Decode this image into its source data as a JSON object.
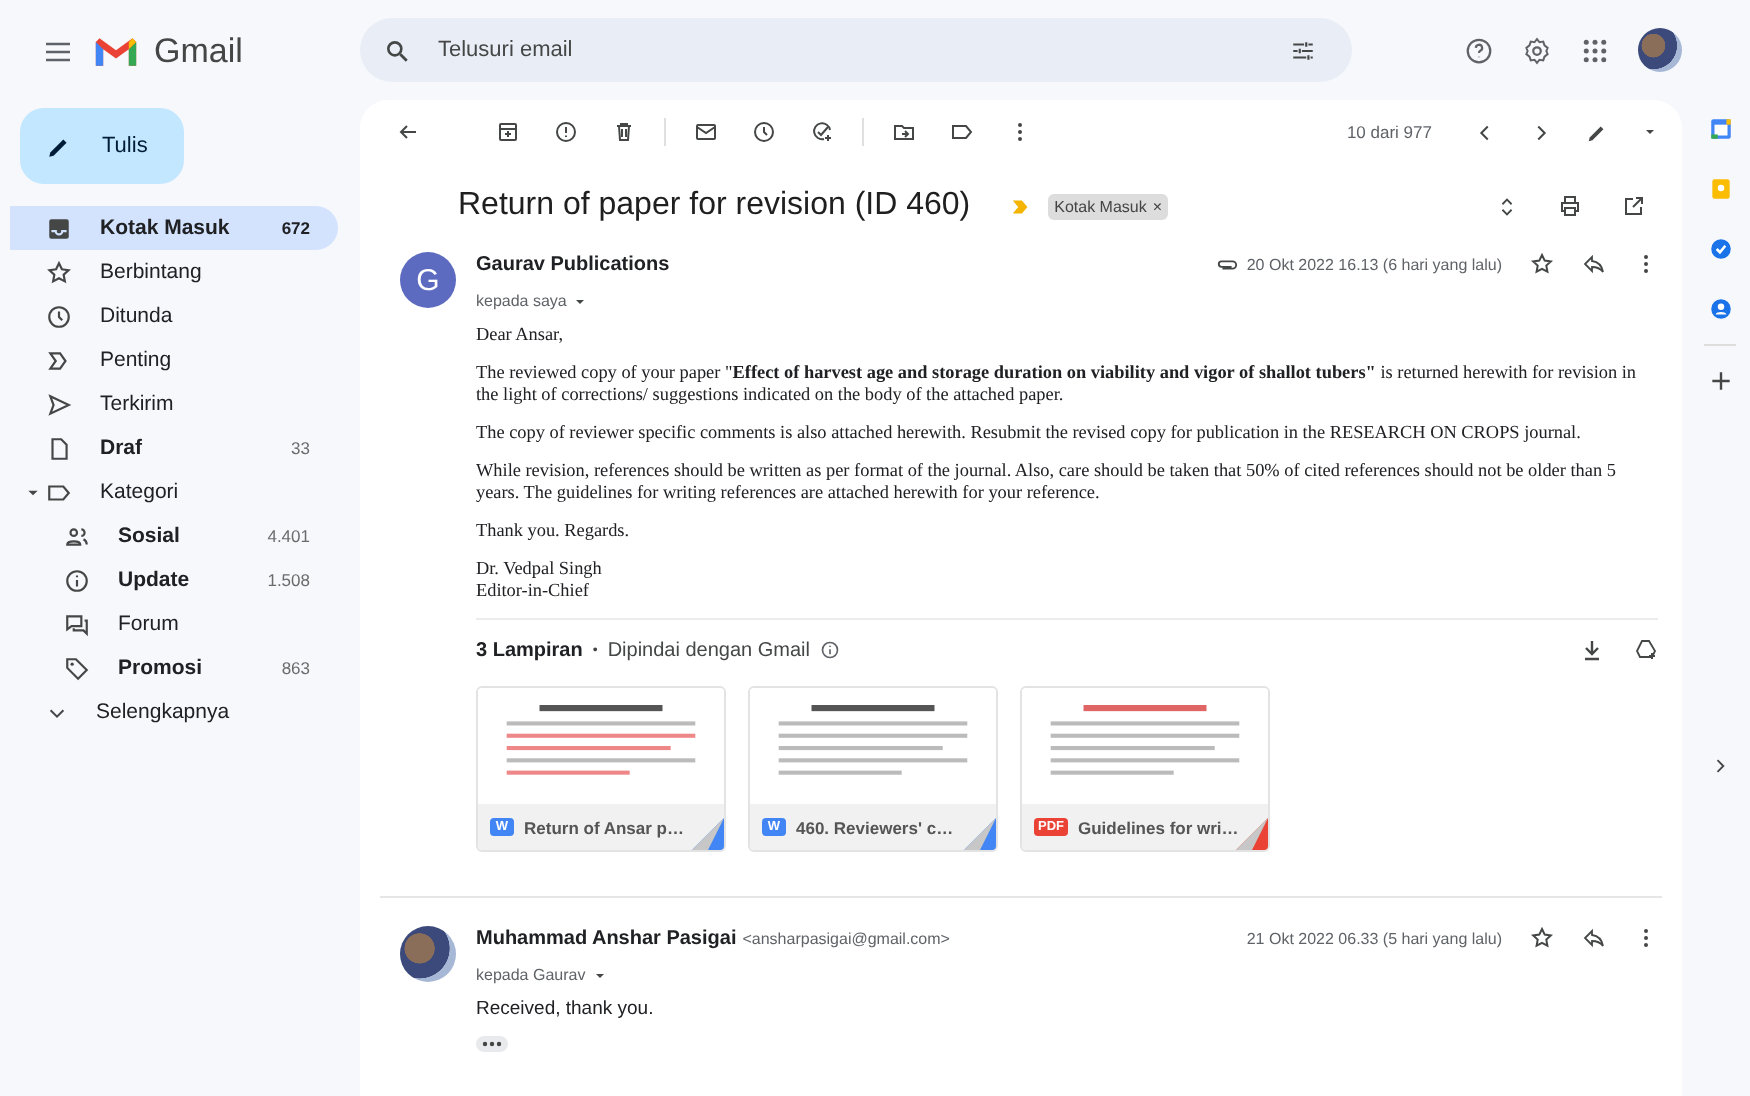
{
  "header": {
    "app_name": "Gmail",
    "search": {
      "placeholder": "Telusuri email"
    }
  },
  "compose_button": "Tulis",
  "sidebar": {
    "items": [
      {
        "label": "Kotak Masuk",
        "count": "672",
        "selected": true,
        "unread": true
      },
      {
        "label": "Berbintang",
        "selected": false,
        "unread": false
      },
      {
        "label": "Ditunda",
        "selected": false,
        "unread": false
      },
      {
        "label": "Penting",
        "selected": false,
        "unread": false
      },
      {
        "label": "Terkirim",
        "selected": false,
        "unread": false
      },
      {
        "label": "Draf",
        "count": "33",
        "selected": false,
        "unread": true
      },
      {
        "label": "Kategori",
        "selected": false,
        "unread": false,
        "expanded": true,
        "children": [
          {
            "label": "Sosial",
            "count": "4.401",
            "selected": false,
            "unread": true
          },
          {
            "label": "Update",
            "count": "1.508",
            "selected": false,
            "unread": true
          },
          {
            "label": "Forum",
            "selected": false,
            "unread": false
          },
          {
            "label": "Promosi",
            "count": "863",
            "selected": false,
            "unread": true
          }
        ]
      }
    ],
    "more": "Selengkapnya"
  },
  "toolbar": {
    "pagination": "10 dari 977"
  },
  "thread": {
    "subject": "Return of paper for revision (ID 460)",
    "important": true,
    "labels": [
      {
        "name": "Kotak Masuk",
        "remove": "×"
      }
    ]
  },
  "messages": [
    {
      "avatar": {
        "kind": "letter",
        "letter": "G"
      },
      "sender": "Gaurav Publications",
      "recipient": "kepada saya",
      "date": "20 Okt 2022 16.13 (6 hari yang lalu)",
      "has_attachment": true,
      "body": [
        "Dear Ansar,",
        "The reviewed copy of your paper \"**Effect of harvest age and storage duration on viability and vigor of shallot tubers\"** is returned herewith for revision in the light of corrections/ suggestions indicated on the body of the attached paper.",
        "The copy of reviewer specific comments is also attached herewith. Resubmit the revised copy for publication in  the RESEARCH ON CROPS journal.",
        "While revision, references should be written as per format of the journal. Also, care should be taken that 50% of cited references should not be older than 5 years. The guidelines for writing references are attached herewith for your reference.",
        "Thank you. Regards."
      ],
      "signature": [
        "Dr. Vedpal Singh",
        "Editor-in-Chief"
      ],
      "attachments": {
        "summary": "3 Lampiran",
        "separator": "•",
        "note": "Dipindai dengan Gmail",
        "files": [
          {
            "name": "Return of Ansar p…",
            "kind": "word",
            "badge": "W"
          },
          {
            "name": "460. Reviewers' c…",
            "kind": "word",
            "badge": "W"
          },
          {
            "name": "Guidelines for wri…",
            "kind": "pdf",
            "badge": "PDF"
          }
        ]
      }
    },
    {
      "avatar": {
        "kind": "photo"
      },
      "sender": "Muhammad Anshar Pasigai",
      "email": "<ansharpasigai@gmail.com>",
      "recipient": "kepada Gaurav",
      "date": "21 Okt 2022 06.33 (5 hari yang lalu)",
      "body": [
        "Received, thank you."
      ],
      "trimmed": true
    }
  ]
}
